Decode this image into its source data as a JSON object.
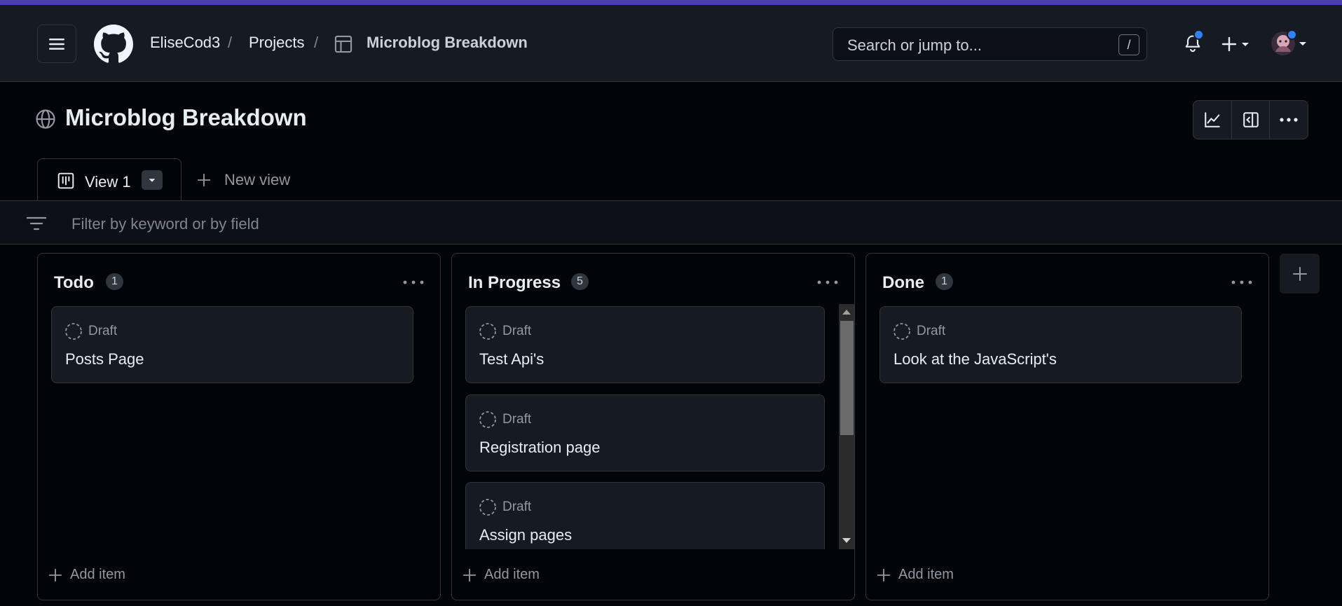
{
  "header": {
    "breadcrumb": {
      "owner": "EliseCod3",
      "section": "Projects",
      "project": "Microblog Breakdown",
      "separator": "/"
    },
    "search": {
      "placeholder": "Search or jump to...",
      "shortcut": "/"
    },
    "icons": [
      "hamburger-icon",
      "github-logo",
      "table-icon",
      "bell-icon",
      "plus-icon",
      "triangle-down-icon",
      "avatar"
    ],
    "accent_color": "#2f81f7"
  },
  "project": {
    "title": "Microblog Breakdown",
    "toolbar_icons": [
      "graph-icon",
      "sidebar-expand-icon",
      "kebab-horizontal-icon"
    ]
  },
  "tabs": [
    {
      "label": "View 1",
      "active": true
    },
    {
      "label": "New view",
      "active": false
    }
  ],
  "filter": {
    "placeholder": "Filter by keyword or by field"
  },
  "board": {
    "add_item_label": "Add item",
    "columns": [
      {
        "name": "Todo",
        "count": "1",
        "cards": [
          {
            "status": "Draft",
            "title": "Posts Page"
          }
        ]
      },
      {
        "name": "In Progress",
        "count": "5",
        "cards": [
          {
            "status": "Draft",
            "title": "Test Api's"
          },
          {
            "status": "Draft",
            "title": "Registration page"
          },
          {
            "status": "Draft",
            "title": "Assign pages"
          }
        ]
      },
      {
        "name": "Done",
        "count": "1",
        "cards": [
          {
            "status": "Draft",
            "title": "Look at the JavaScript's"
          }
        ]
      }
    ]
  }
}
